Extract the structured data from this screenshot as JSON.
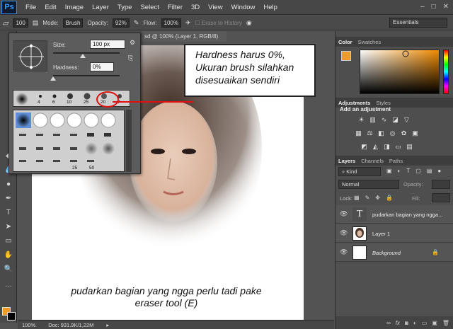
{
  "menubar": {
    "logo": "Ps",
    "items": [
      "File",
      "Edit",
      "Image",
      "Layer",
      "Type",
      "Select",
      "Filter",
      "3D",
      "View",
      "Window",
      "Help"
    ],
    "window_controls": [
      "–",
      "□",
      "✕"
    ]
  },
  "options": {
    "brush_size": "100",
    "mode_label": "Mode:",
    "mode_value": "Brush",
    "opacity_label": "Opacity:",
    "opacity_value": "92%",
    "flow_label": "Flow:",
    "flow_value": "100%",
    "erase_history_label": "Erase to History",
    "workspace": "Essentials"
  },
  "document": {
    "tab_title": "sd @ 100% (Layer 1, RGB/8)",
    "caption_line1": "pudarkan bagian yang ngga perlu tadi pake",
    "caption_line2": "eraser tool (E)",
    "status_zoom": "100%",
    "status_doc": "Doc: 931.9K/1,22M"
  },
  "brush_popup": {
    "size_label": "Size:",
    "size_value": "100 px",
    "size_level": 0.45,
    "hardness_label": "Hardness:",
    "hardness_value": "0%",
    "hardness_level": 0.0,
    "recent_sizes": [
      "4",
      "6",
      "10",
      "25",
      "20",
      "7"
    ],
    "grid_labels": [
      "25",
      "50"
    ]
  },
  "callout": {
    "line1": "Hardness harus 0%,",
    "line2": "Ukuran brush silahkan",
    "line3": "disesuaikan sendiri"
  },
  "color_panel": {
    "tabs": [
      "Color",
      "Swatches"
    ],
    "foreground": "#f09a2a"
  },
  "adjustments": {
    "tabs": [
      "Adjustments",
      "Styles"
    ],
    "title": "Add an adjustment"
  },
  "layers": {
    "tabs": [
      "Layers",
      "Channels",
      "Paths"
    ],
    "kind": "Kind",
    "blend_mode": "Normal",
    "opacity_label": "Opacity:",
    "lock_label": "Lock:",
    "fill_label": "Fill:",
    "rows": [
      {
        "name": "pudarkan bagian yang ngga...",
        "kind": "T"
      },
      {
        "name": "Layer 1",
        "kind": "image"
      },
      {
        "name": "Background",
        "kind": "white"
      }
    ],
    "footer_icons": [
      "link-icon",
      "fx-icon",
      "mask-icon",
      "adjustment-icon",
      "folder-icon",
      "new-layer-icon",
      "trash-icon"
    ]
  },
  "colors": {
    "accent": "#f09a2a",
    "callout_red": "#dd1111"
  }
}
